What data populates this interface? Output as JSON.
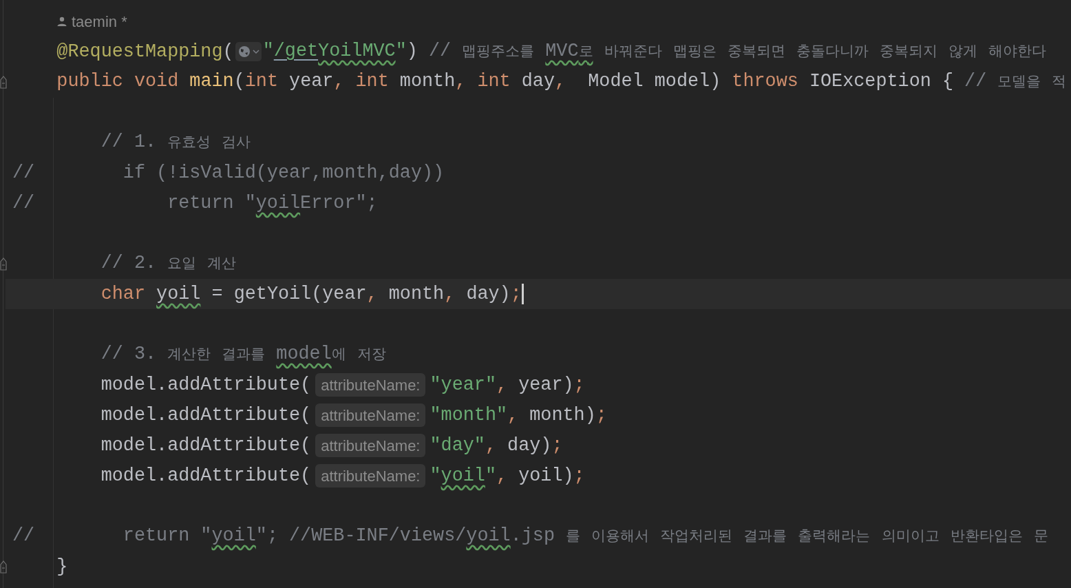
{
  "editor": {
    "lines": [
      {
        "kind": "author",
        "text": "taemin *"
      },
      {
        "kind": "code",
        "fold": false,
        "current": false,
        "tokens": [
          {
            "text": "    @RequestMapping",
            "kind": "annotation",
            "typo": false
          },
          {
            "text": "(",
            "kind": "plain",
            "typo": false
          },
          {
            "kind": "url_icon"
          },
          {
            "text": "\"",
            "kind": "string",
            "typo": false
          },
          {
            "text": "/get",
            "kind": "url",
            "typo": false
          },
          {
            "text": "YoilMVC",
            "kind": "url",
            "typo": true
          },
          {
            "text": "\"",
            "kind": "string",
            "typo": false
          },
          {
            "text": ") ",
            "kind": "plain",
            "typo": false
          },
          {
            "text": "// 맵핑주소를 ",
            "kind": "comment",
            "typo": false
          },
          {
            "text": "MVC로",
            "kind": "comment",
            "typo": true
          },
          {
            "text": " 바꿔준다 맵핑은 중복되면 충돌다니까 중복되지 않게 해야한다",
            "kind": "comment",
            "typo": false
          }
        ]
      },
      {
        "kind": "code",
        "fold": true,
        "current": false,
        "tokens": [
          {
            "text": "    public void ",
            "kind": "keyword",
            "typo": false
          },
          {
            "text": "main",
            "kind": "function",
            "typo": false
          },
          {
            "text": "(",
            "kind": "plain",
            "typo": false
          },
          {
            "text": "int",
            "kind": "keyword",
            "typo": false
          },
          {
            "text": " year",
            "kind": "plain",
            "typo": false
          },
          {
            "text": ", int",
            "kind": "keyword",
            "typo": false
          },
          {
            "text": " month",
            "kind": "plain",
            "typo": false
          },
          {
            "text": ", int",
            "kind": "keyword",
            "typo": false
          },
          {
            "text": " day",
            "kind": "plain",
            "typo": false
          },
          {
            "text": ",",
            "kind": "keyword",
            "typo": false
          },
          {
            "text": "  Model model) ",
            "kind": "plain",
            "typo": false
          },
          {
            "text": "throws",
            "kind": "keyword",
            "typo": false
          },
          {
            "text": " IOException { ",
            "kind": "plain",
            "typo": false
          },
          {
            "text": "// 모델을 적",
            "kind": "comment",
            "typo": false
          }
        ]
      },
      {
        "kind": "blank"
      },
      {
        "kind": "code",
        "fold": false,
        "current": false,
        "tokens": [
          {
            "text": "        // 1. 유효성 검사",
            "kind": "comment",
            "typo": false
          }
        ]
      },
      {
        "kind": "code",
        "fold": false,
        "current": false,
        "tokens": [
          {
            "text": "//        if (!isValid(year,month,day))",
            "kind": "comment",
            "typo": false
          }
        ]
      },
      {
        "kind": "code",
        "fold": false,
        "current": false,
        "tokens": [
          {
            "text": "//            return \"",
            "kind": "comment",
            "typo": false
          },
          {
            "text": "yoil",
            "kind": "comment",
            "typo": true
          },
          {
            "text": "Error\";",
            "kind": "comment",
            "typo": false
          }
        ]
      },
      {
        "kind": "blank"
      },
      {
        "kind": "code",
        "fold": true,
        "current": false,
        "tokens": [
          {
            "text": "        // 2. 요일 계산",
            "kind": "comment",
            "typo": false
          }
        ]
      },
      {
        "kind": "code",
        "fold": false,
        "current": true,
        "tokens": [
          {
            "text": "        char ",
            "kind": "keyword",
            "typo": false
          },
          {
            "text": "yoil",
            "kind": "plain",
            "typo": true
          },
          {
            "text": " = getYoil(year",
            "kind": "plain",
            "typo": false
          },
          {
            "text": ",",
            "kind": "keyword",
            "typo": false
          },
          {
            "text": " month",
            "kind": "plain",
            "typo": false
          },
          {
            "text": ",",
            "kind": "keyword",
            "typo": false
          },
          {
            "text": " day)",
            "kind": "plain",
            "typo": false
          },
          {
            "text": ";",
            "kind": "keyword",
            "typo": false
          }
        ]
      },
      {
        "kind": "blank"
      },
      {
        "kind": "code",
        "fold": false,
        "current": false,
        "tokens": [
          {
            "text": "        // 3. 계산한 결과를 ",
            "kind": "comment",
            "typo": false
          },
          {
            "text": "model",
            "kind": "comment",
            "typo": true
          },
          {
            "text": "에 저장",
            "kind": "comment",
            "typo": false
          }
        ]
      },
      {
        "kind": "code",
        "fold": false,
        "current": false,
        "tokens": [
          {
            "text": "        model.addAttribute(",
            "kind": "plain",
            "typo": false
          },
          {
            "text": "attributeName:",
            "kind": "hint"
          },
          {
            "text": "\"year\"",
            "kind": "string",
            "typo": false
          },
          {
            "text": ",",
            "kind": "keyword",
            "typo": false
          },
          {
            "text": " year)",
            "kind": "plain",
            "typo": false
          },
          {
            "text": ";",
            "kind": "keyword",
            "typo": false
          }
        ]
      },
      {
        "kind": "code",
        "fold": false,
        "current": false,
        "tokens": [
          {
            "text": "        model.addAttribute(",
            "kind": "plain",
            "typo": false
          },
          {
            "text": "attributeName:",
            "kind": "hint"
          },
          {
            "text": "\"month\"",
            "kind": "string",
            "typo": false
          },
          {
            "text": ",",
            "kind": "keyword",
            "typo": false
          },
          {
            "text": " month)",
            "kind": "plain",
            "typo": false
          },
          {
            "text": ";",
            "kind": "keyword",
            "typo": false
          }
        ]
      },
      {
        "kind": "code",
        "fold": false,
        "current": false,
        "tokens": [
          {
            "text": "        model.addAttribute(",
            "kind": "plain",
            "typo": false
          },
          {
            "text": "attributeName:",
            "kind": "hint"
          },
          {
            "text": "\"day\"",
            "kind": "string",
            "typo": false
          },
          {
            "text": ",",
            "kind": "keyword",
            "typo": false
          },
          {
            "text": " day)",
            "kind": "plain",
            "typo": false
          },
          {
            "text": ";",
            "kind": "keyword",
            "typo": false
          }
        ]
      },
      {
        "kind": "code",
        "fold": false,
        "current": false,
        "tokens": [
          {
            "text": "        model.addAttribute(",
            "kind": "plain",
            "typo": false
          },
          {
            "text": "attributeName:",
            "kind": "hint"
          },
          {
            "text": "\"",
            "kind": "string",
            "typo": false
          },
          {
            "text": "yoil",
            "kind": "string",
            "typo": true
          },
          {
            "text": "\"",
            "kind": "string",
            "typo": false
          },
          {
            "text": ",",
            "kind": "keyword",
            "typo": false
          },
          {
            "text": " yoil)",
            "kind": "plain",
            "typo": false
          },
          {
            "text": ";",
            "kind": "keyword",
            "typo": false
          }
        ]
      },
      {
        "kind": "blank"
      },
      {
        "kind": "code",
        "fold": false,
        "current": false,
        "tokens": [
          {
            "text": "//        return \"",
            "kind": "comment",
            "typo": false
          },
          {
            "text": "yoil",
            "kind": "comment",
            "typo": true
          },
          {
            "text": "\"; //WEB-INF/views/",
            "kind": "comment",
            "typo": false
          },
          {
            "text": "yoil",
            "kind": "comment",
            "typo": true
          },
          {
            "text": ".jsp 를 이용해서 작업처리된 결과를 출력해라는 의미이고 반환타입은 문",
            "kind": "comment",
            "typo": false
          }
        ]
      },
      {
        "kind": "code",
        "fold": true,
        "current": false,
        "tokens": [
          {
            "text": "    }",
            "kind": "plain",
            "typo": false
          }
        ]
      }
    ]
  }
}
